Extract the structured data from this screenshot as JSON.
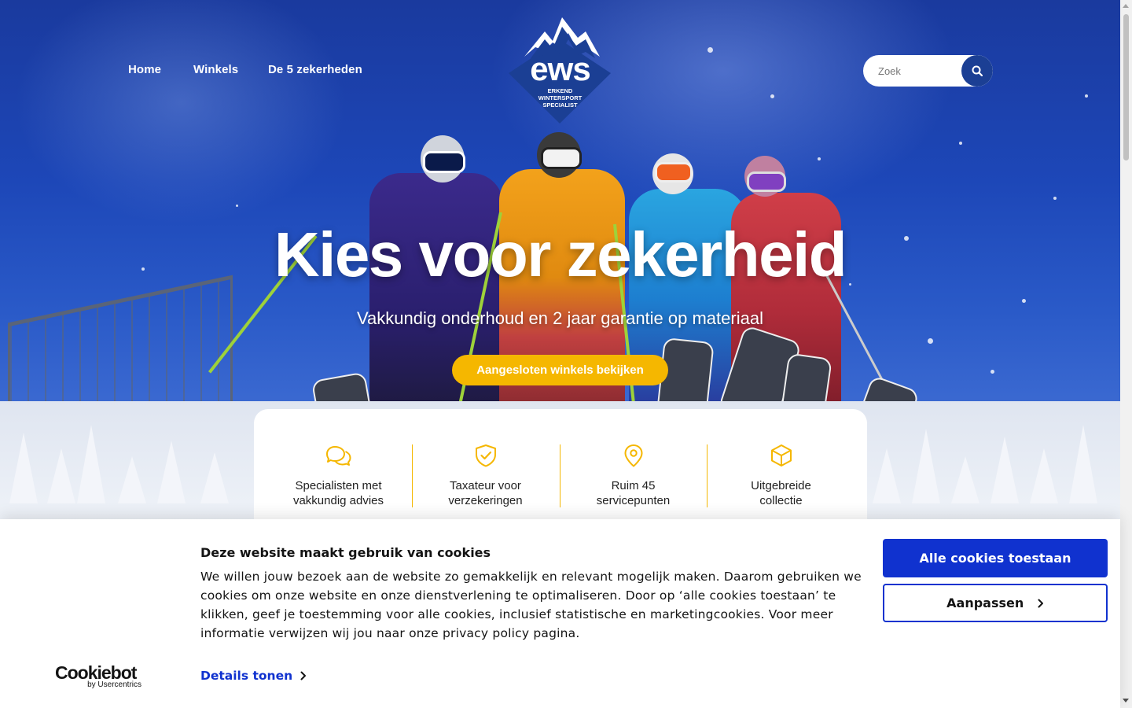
{
  "nav": {
    "links": [
      {
        "label": "Home"
      },
      {
        "label": "Winkels"
      },
      {
        "label": "De 5 zekerheden"
      }
    ]
  },
  "logo": {
    "text": "ews",
    "tagline_line1": "ERKEND",
    "tagline_line2": "WINTERSPORT",
    "tagline_line3": "SPECIALIST"
  },
  "search": {
    "placeholder": "Zoek",
    "value": ""
  },
  "hero": {
    "title": "Kies voor zekerheid",
    "subtitle": "Vakkundig onderhoud en 2 jaar garantie op materiaal",
    "cta_label": "Aangesloten winkels bekijken"
  },
  "usps": [
    {
      "icon": "chat-bubbles-icon",
      "line1": "Specialisten met",
      "line2": "vakkundig advies"
    },
    {
      "icon": "shield-check-icon",
      "line1": "Taxateur voor",
      "line2": "verzekeringen"
    },
    {
      "icon": "map-pin-icon",
      "line1": "Ruim 45",
      "line2": "servicepunten"
    },
    {
      "icon": "box-icon",
      "line1": "Uitgebreide",
      "line2": "collectie"
    }
  ],
  "cookie_banner": {
    "title": "Deze website maakt gebruik van cookies",
    "body": "We willen jouw bezoek aan de website zo gemakkelijk en relevant mogelijk maken. Daarom gebruiken we cookies om onze website en onze dienstverlening te optimaliseren. Door op ‘alle cookies toestaan’ te klikken, geef je toestemming voor alle cookies, inclusief statistische en marketingcookies. Voor meer informatie verwijzen wij jou naar onze privacy policy pagina.",
    "details_label": "Details tonen",
    "allow_all_label": "Alle cookies toestaan",
    "customize_label": "Aanpassen",
    "brand": "Cookiebot",
    "brand_sub": "by Usercentrics"
  },
  "colors": {
    "accent_yellow": "#f5b700",
    "brand_navy": "#1b3f94",
    "cookie_blue": "#1032cf"
  }
}
